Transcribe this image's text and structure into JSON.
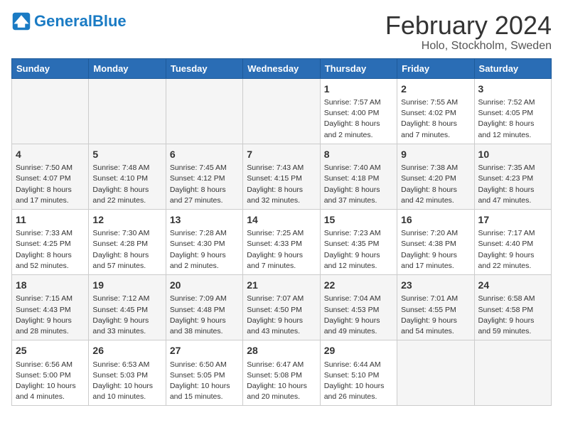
{
  "logo": {
    "text_general": "General",
    "text_blue": "Blue"
  },
  "header": {
    "title": "February 2024",
    "subtitle": "Holo, Stockholm, Sweden"
  },
  "weekdays": [
    "Sunday",
    "Monday",
    "Tuesday",
    "Wednesday",
    "Thursday",
    "Friday",
    "Saturday"
  ],
  "weeks": [
    [
      {
        "day": "",
        "info": ""
      },
      {
        "day": "",
        "info": ""
      },
      {
        "day": "",
        "info": ""
      },
      {
        "day": "",
        "info": ""
      },
      {
        "day": "1",
        "info": "Sunrise: 7:57 AM\nSunset: 4:00 PM\nDaylight: 8 hours\nand 2 minutes."
      },
      {
        "day": "2",
        "info": "Sunrise: 7:55 AM\nSunset: 4:02 PM\nDaylight: 8 hours\nand 7 minutes."
      },
      {
        "day": "3",
        "info": "Sunrise: 7:52 AM\nSunset: 4:05 PM\nDaylight: 8 hours\nand 12 minutes."
      }
    ],
    [
      {
        "day": "4",
        "info": "Sunrise: 7:50 AM\nSunset: 4:07 PM\nDaylight: 8 hours\nand 17 minutes."
      },
      {
        "day": "5",
        "info": "Sunrise: 7:48 AM\nSunset: 4:10 PM\nDaylight: 8 hours\nand 22 minutes."
      },
      {
        "day": "6",
        "info": "Sunrise: 7:45 AM\nSunset: 4:12 PM\nDaylight: 8 hours\nand 27 minutes."
      },
      {
        "day": "7",
        "info": "Sunrise: 7:43 AM\nSunset: 4:15 PM\nDaylight: 8 hours\nand 32 minutes."
      },
      {
        "day": "8",
        "info": "Sunrise: 7:40 AM\nSunset: 4:18 PM\nDaylight: 8 hours\nand 37 minutes."
      },
      {
        "day": "9",
        "info": "Sunrise: 7:38 AM\nSunset: 4:20 PM\nDaylight: 8 hours\nand 42 minutes."
      },
      {
        "day": "10",
        "info": "Sunrise: 7:35 AM\nSunset: 4:23 PM\nDaylight: 8 hours\nand 47 minutes."
      }
    ],
    [
      {
        "day": "11",
        "info": "Sunrise: 7:33 AM\nSunset: 4:25 PM\nDaylight: 8 hours\nand 52 minutes."
      },
      {
        "day": "12",
        "info": "Sunrise: 7:30 AM\nSunset: 4:28 PM\nDaylight: 8 hours\nand 57 minutes."
      },
      {
        "day": "13",
        "info": "Sunrise: 7:28 AM\nSunset: 4:30 PM\nDaylight: 9 hours\nand 2 minutes."
      },
      {
        "day": "14",
        "info": "Sunrise: 7:25 AM\nSunset: 4:33 PM\nDaylight: 9 hours\nand 7 minutes."
      },
      {
        "day": "15",
        "info": "Sunrise: 7:23 AM\nSunset: 4:35 PM\nDaylight: 9 hours\nand 12 minutes."
      },
      {
        "day": "16",
        "info": "Sunrise: 7:20 AM\nSunset: 4:38 PM\nDaylight: 9 hours\nand 17 minutes."
      },
      {
        "day": "17",
        "info": "Sunrise: 7:17 AM\nSunset: 4:40 PM\nDaylight: 9 hours\nand 22 minutes."
      }
    ],
    [
      {
        "day": "18",
        "info": "Sunrise: 7:15 AM\nSunset: 4:43 PM\nDaylight: 9 hours\nand 28 minutes."
      },
      {
        "day": "19",
        "info": "Sunrise: 7:12 AM\nSunset: 4:45 PM\nDaylight: 9 hours\nand 33 minutes."
      },
      {
        "day": "20",
        "info": "Sunrise: 7:09 AM\nSunset: 4:48 PM\nDaylight: 9 hours\nand 38 minutes."
      },
      {
        "day": "21",
        "info": "Sunrise: 7:07 AM\nSunset: 4:50 PM\nDaylight: 9 hours\nand 43 minutes."
      },
      {
        "day": "22",
        "info": "Sunrise: 7:04 AM\nSunset: 4:53 PM\nDaylight: 9 hours\nand 49 minutes."
      },
      {
        "day": "23",
        "info": "Sunrise: 7:01 AM\nSunset: 4:55 PM\nDaylight: 9 hours\nand 54 minutes."
      },
      {
        "day": "24",
        "info": "Sunrise: 6:58 AM\nSunset: 4:58 PM\nDaylight: 9 hours\nand 59 minutes."
      }
    ],
    [
      {
        "day": "25",
        "info": "Sunrise: 6:56 AM\nSunset: 5:00 PM\nDaylight: 10 hours\nand 4 minutes."
      },
      {
        "day": "26",
        "info": "Sunrise: 6:53 AM\nSunset: 5:03 PM\nDaylight: 10 hours\nand 10 minutes."
      },
      {
        "day": "27",
        "info": "Sunrise: 6:50 AM\nSunset: 5:05 PM\nDaylight: 10 hours\nand 15 minutes."
      },
      {
        "day": "28",
        "info": "Sunrise: 6:47 AM\nSunset: 5:08 PM\nDaylight: 10 hours\nand 20 minutes."
      },
      {
        "day": "29",
        "info": "Sunrise: 6:44 AM\nSunset: 5:10 PM\nDaylight: 10 hours\nand 26 minutes."
      },
      {
        "day": "",
        "info": ""
      },
      {
        "day": "",
        "info": ""
      }
    ]
  ]
}
